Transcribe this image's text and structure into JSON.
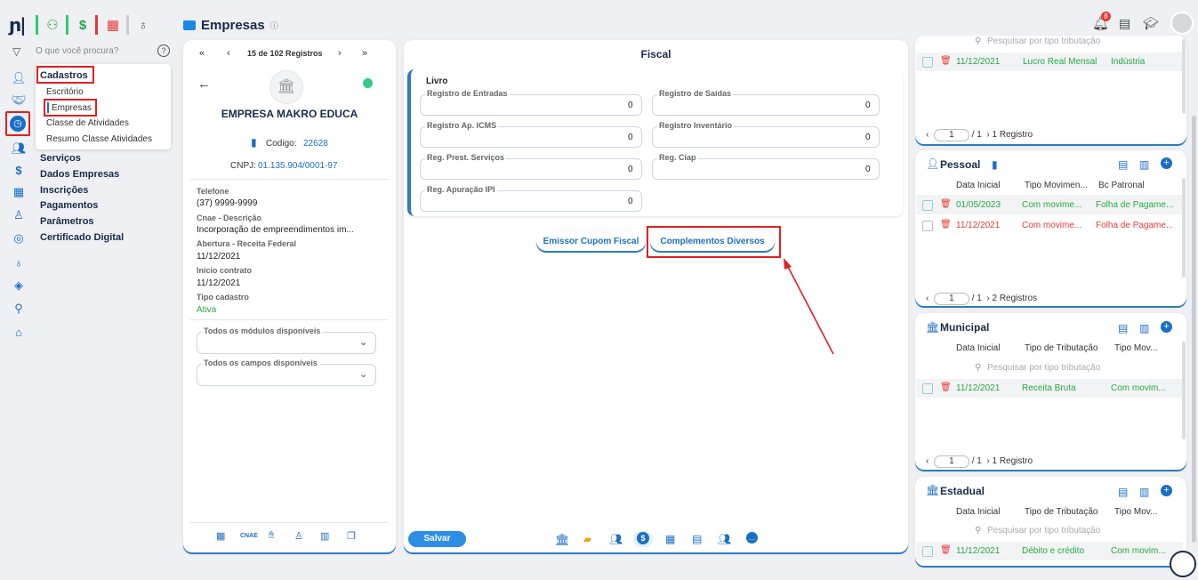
{
  "topbar": {
    "icons": [
      "users-icon",
      "dollar-icon",
      "grid-icon",
      "moneybag-icon"
    ],
    "page_title": "Empresas",
    "notif_count": "8"
  },
  "search": {
    "placeholder": "O que você procura?"
  },
  "sidebar": {
    "menu": [
      {
        "label": "Cadastros"
      },
      {
        "label": "Serviços"
      },
      {
        "label": "Dados Empresas"
      },
      {
        "label": "Inscrições"
      },
      {
        "label": "Pagamentos"
      },
      {
        "label": "Parâmetros"
      },
      {
        "label": "Certificado Digital"
      }
    ],
    "submenu": [
      {
        "label": "Escritório"
      },
      {
        "label": "Empresas"
      },
      {
        "label": "Classe de Atividades"
      },
      {
        "label": "Resumo Classe Atividades"
      }
    ]
  },
  "record": {
    "nav_label": "15 de 102 Registros",
    "company_name": "EMPRESA MAKRO EDUCA",
    "codigo_label": "Codigo:",
    "codigo": "22628",
    "cnpj_label": "CNPJ:",
    "cnpj": "01.135.904/0001-97",
    "telefone_label": "Telefone",
    "telefone": "(37) 9999-9999",
    "cnae_label": "Cnae - Descrição",
    "cnae": "Incorporação de empreendimentos im...",
    "abertura_label": "Abertura - Receita Federal",
    "abertura": "11/12/2021",
    "inicio_label": "Inicio contrato",
    "inicio": "11/12/2021",
    "tipo_label": "Tipo cadastro",
    "tipo": "Ativa",
    "modulos_label": "Todos os módulos disponíveis",
    "campos_label": "Todos os campos disponíveis",
    "cnae_tab": "CNAE"
  },
  "fiscal": {
    "title": "Fiscal",
    "section": "Livro",
    "fields": [
      {
        "label": "Registro de Entradas",
        "value": "0"
      },
      {
        "label": "Registro de Saídas",
        "value": "0"
      },
      {
        "label": "Registro Ap. ICMS",
        "value": "0"
      },
      {
        "label": "Registro Inventário",
        "value": "0"
      },
      {
        "label": "Reg. Prest. Serviços",
        "value": "0"
      },
      {
        "label": "Reg. Ciap",
        "value": "0"
      },
      {
        "label": "Reg. Apuração IPI",
        "value": "0"
      }
    ],
    "btn_emissor": "Emissor Cupom Fiscal",
    "btn_complementos": "Complementos Diversos",
    "save": "Salvar"
  },
  "right": {
    "search_placeholder": "Pesquisar por tipo tributação",
    "top": {
      "row": {
        "date": "11/12/2021",
        "c2": "Lucro Real Mensal",
        "c3": "Indústria"
      },
      "page": "1",
      "total": "/ 1",
      "count": "1 Registro"
    },
    "pessoal": {
      "title": "Pessoal",
      "cols": [
        "Data Inicial",
        "Tipo Movimen...",
        "Bc Patronal"
      ],
      "rows": [
        {
          "date": "01/05/2023",
          "c2": "Com movime...",
          "c3": "Folha de Pagame..."
        },
        {
          "date": "11/12/2021",
          "c2": "Com movime...",
          "c3": "Folha de Pagame..."
        }
      ],
      "page": "1",
      "total": "/ 1",
      "count": "2 Registros"
    },
    "municipal": {
      "title": "Municipal",
      "cols": [
        "Data Inicial",
        "Tipo de Tributação",
        "Tipo Mov..."
      ],
      "row": {
        "date": "11/12/2021",
        "c2": "Receita Bruta",
        "c3": "Com movim..."
      },
      "page": "1",
      "total": "/ 1",
      "count": "1 Registro"
    },
    "estadual": {
      "title": "Estadual",
      "cols": [
        "Data Inicial",
        "Tipo de Tributação",
        "Tipo Mov..."
      ],
      "row": {
        "date": "11/12/2021",
        "c2": "Débito e crédito",
        "c3": "Com movim..."
      }
    }
  }
}
